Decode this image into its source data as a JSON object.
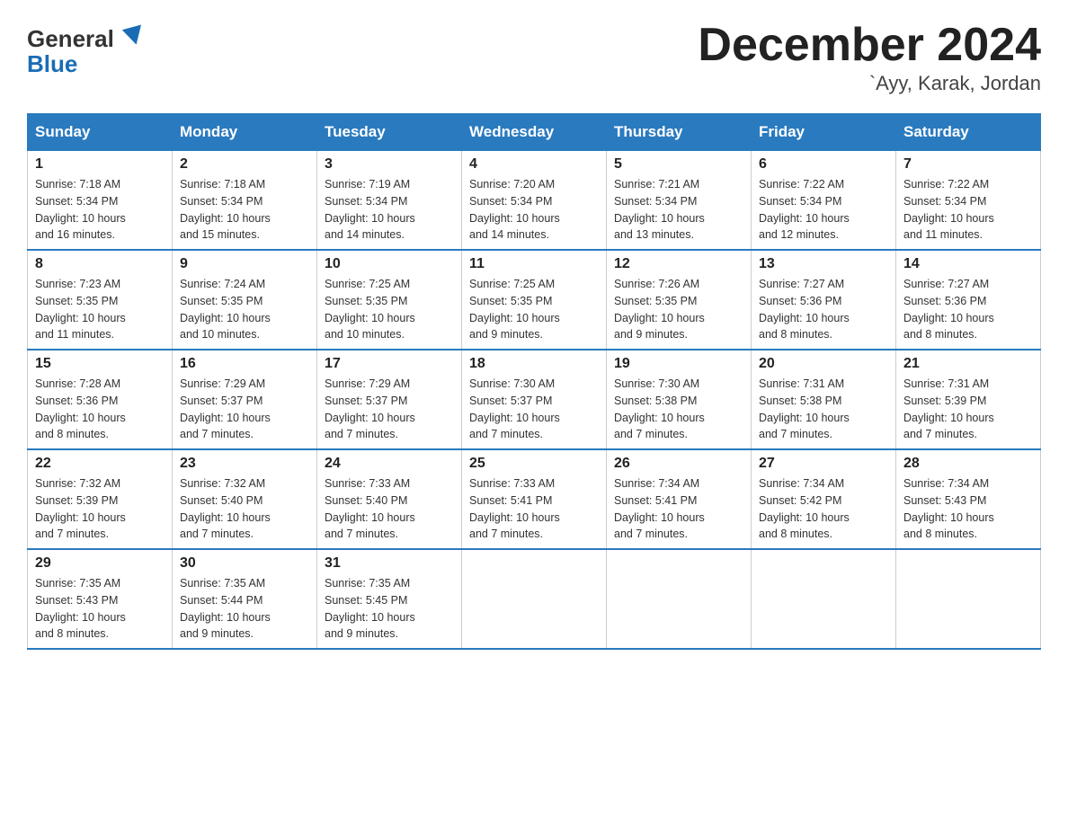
{
  "header": {
    "logo_general": "General",
    "logo_blue": "Blue",
    "title": "December 2024",
    "location": "`Ayy, Karak, Jordan"
  },
  "days_of_week": [
    "Sunday",
    "Monday",
    "Tuesday",
    "Wednesday",
    "Thursday",
    "Friday",
    "Saturday"
  ],
  "weeks": [
    [
      {
        "day": "1",
        "sunrise": "7:18 AM",
        "sunset": "5:34 PM",
        "daylight": "10 hours and 16 minutes."
      },
      {
        "day": "2",
        "sunrise": "7:18 AM",
        "sunset": "5:34 PM",
        "daylight": "10 hours and 15 minutes."
      },
      {
        "day": "3",
        "sunrise": "7:19 AM",
        "sunset": "5:34 PM",
        "daylight": "10 hours and 14 minutes."
      },
      {
        "day": "4",
        "sunrise": "7:20 AM",
        "sunset": "5:34 PM",
        "daylight": "10 hours and 14 minutes."
      },
      {
        "day": "5",
        "sunrise": "7:21 AM",
        "sunset": "5:34 PM",
        "daylight": "10 hours and 13 minutes."
      },
      {
        "day": "6",
        "sunrise": "7:22 AM",
        "sunset": "5:34 PM",
        "daylight": "10 hours and 12 minutes."
      },
      {
        "day": "7",
        "sunrise": "7:22 AM",
        "sunset": "5:34 PM",
        "daylight": "10 hours and 11 minutes."
      }
    ],
    [
      {
        "day": "8",
        "sunrise": "7:23 AM",
        "sunset": "5:35 PM",
        "daylight": "10 hours and 11 minutes."
      },
      {
        "day": "9",
        "sunrise": "7:24 AM",
        "sunset": "5:35 PM",
        "daylight": "10 hours and 10 minutes."
      },
      {
        "day": "10",
        "sunrise": "7:25 AM",
        "sunset": "5:35 PM",
        "daylight": "10 hours and 10 minutes."
      },
      {
        "day": "11",
        "sunrise": "7:25 AM",
        "sunset": "5:35 PM",
        "daylight": "10 hours and 9 minutes."
      },
      {
        "day": "12",
        "sunrise": "7:26 AM",
        "sunset": "5:35 PM",
        "daylight": "10 hours and 9 minutes."
      },
      {
        "day": "13",
        "sunrise": "7:27 AM",
        "sunset": "5:36 PM",
        "daylight": "10 hours and 8 minutes."
      },
      {
        "day": "14",
        "sunrise": "7:27 AM",
        "sunset": "5:36 PM",
        "daylight": "10 hours and 8 minutes."
      }
    ],
    [
      {
        "day": "15",
        "sunrise": "7:28 AM",
        "sunset": "5:36 PM",
        "daylight": "10 hours and 8 minutes."
      },
      {
        "day": "16",
        "sunrise": "7:29 AM",
        "sunset": "5:37 PM",
        "daylight": "10 hours and 7 minutes."
      },
      {
        "day": "17",
        "sunrise": "7:29 AM",
        "sunset": "5:37 PM",
        "daylight": "10 hours and 7 minutes."
      },
      {
        "day": "18",
        "sunrise": "7:30 AM",
        "sunset": "5:37 PM",
        "daylight": "10 hours and 7 minutes."
      },
      {
        "day": "19",
        "sunrise": "7:30 AM",
        "sunset": "5:38 PM",
        "daylight": "10 hours and 7 minutes."
      },
      {
        "day": "20",
        "sunrise": "7:31 AM",
        "sunset": "5:38 PM",
        "daylight": "10 hours and 7 minutes."
      },
      {
        "day": "21",
        "sunrise": "7:31 AM",
        "sunset": "5:39 PM",
        "daylight": "10 hours and 7 minutes."
      }
    ],
    [
      {
        "day": "22",
        "sunrise": "7:32 AM",
        "sunset": "5:39 PM",
        "daylight": "10 hours and 7 minutes."
      },
      {
        "day": "23",
        "sunrise": "7:32 AM",
        "sunset": "5:40 PM",
        "daylight": "10 hours and 7 minutes."
      },
      {
        "day": "24",
        "sunrise": "7:33 AM",
        "sunset": "5:40 PM",
        "daylight": "10 hours and 7 minutes."
      },
      {
        "day": "25",
        "sunrise": "7:33 AM",
        "sunset": "5:41 PM",
        "daylight": "10 hours and 7 minutes."
      },
      {
        "day": "26",
        "sunrise": "7:34 AM",
        "sunset": "5:41 PM",
        "daylight": "10 hours and 7 minutes."
      },
      {
        "day": "27",
        "sunrise": "7:34 AM",
        "sunset": "5:42 PM",
        "daylight": "10 hours and 8 minutes."
      },
      {
        "day": "28",
        "sunrise": "7:34 AM",
        "sunset": "5:43 PM",
        "daylight": "10 hours and 8 minutes."
      }
    ],
    [
      {
        "day": "29",
        "sunrise": "7:35 AM",
        "sunset": "5:43 PM",
        "daylight": "10 hours and 8 minutes."
      },
      {
        "day": "30",
        "sunrise": "7:35 AM",
        "sunset": "5:44 PM",
        "daylight": "10 hours and 9 minutes."
      },
      {
        "day": "31",
        "sunrise": "7:35 AM",
        "sunset": "5:45 PM",
        "daylight": "10 hours and 9 minutes."
      },
      null,
      null,
      null,
      null
    ]
  ],
  "labels": {
    "sunrise": "Sunrise:",
    "sunset": "Sunset:",
    "daylight": "Daylight:"
  }
}
